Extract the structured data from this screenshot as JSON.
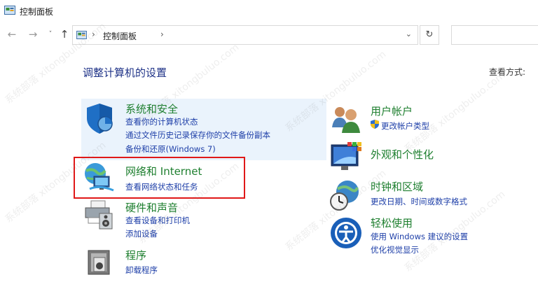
{
  "window": {
    "title": "控制面板"
  },
  "nav": {
    "back": "←",
    "forward": "→",
    "recent": "˅",
    "up": "↑",
    "address_separator": "›",
    "breadcrumb": "控制面板",
    "breadcrumb_arrow": "›",
    "dropdown": "⌄",
    "refresh": "↻",
    "search_placeholder": ""
  },
  "heading": "调整计算机的设置",
  "view_by": "查看方式: ",
  "categories": {
    "system": {
      "name": "系统和安全",
      "links": [
        "查看你的计算机状态",
        "通过文件历史记录保存你的文件备份副本",
        "备份和还原(Windows 7)"
      ]
    },
    "network": {
      "name": "网络和 Internet",
      "links": [
        "查看网络状态和任务"
      ]
    },
    "hardware": {
      "name": "硬件和声音",
      "links": [
        "查看设备和打印机",
        "添加设备"
      ]
    },
    "programs": {
      "name": "程序",
      "links": [
        "卸载程序"
      ]
    },
    "users": {
      "name": "用户帐户",
      "links": [
        "更改帐户类型"
      ]
    },
    "appearance": {
      "name": "外观和个性化",
      "links": []
    },
    "clock": {
      "name": "时钟和区域",
      "links": [
        "更改日期、时间或数字格式"
      ]
    },
    "ease": {
      "name": "轻松使用",
      "links": [
        "使用 Windows 建议的设置",
        "优化视觉显示"
      ]
    }
  },
  "colors": {
    "category_name": "#1e7f2f",
    "link": "#1e3fa8",
    "heading": "#1e3287",
    "highlight": "#e01818",
    "hover_bg": "#eaf3fc"
  },
  "watermark": "系统部落 xitongbuluo.com"
}
